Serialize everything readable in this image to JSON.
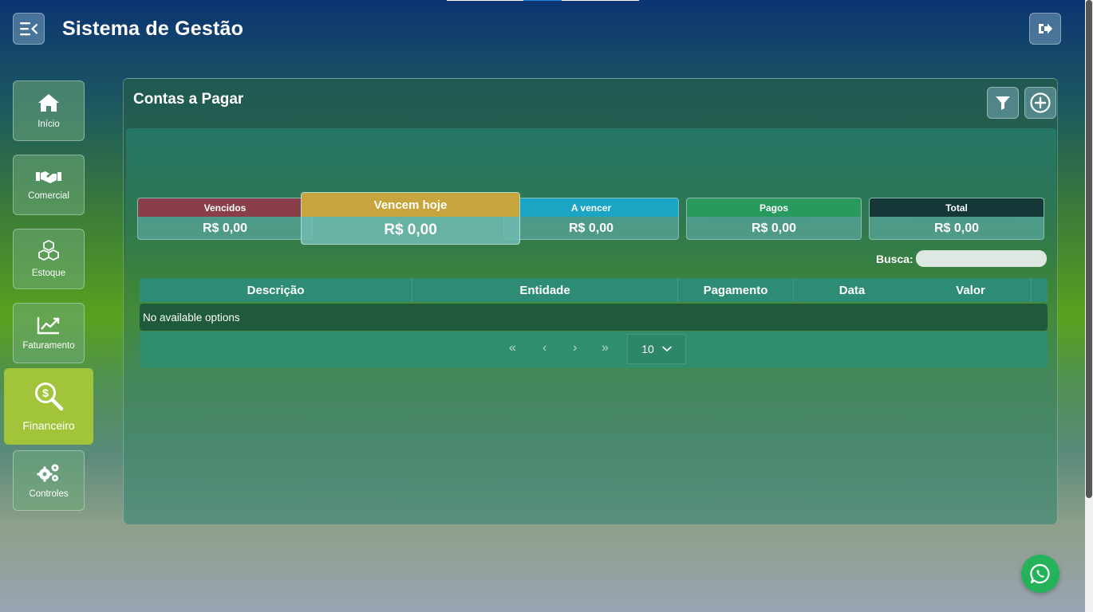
{
  "app": {
    "title": "Sistema de Gestão"
  },
  "header": {
    "menu_icon": "menu-collapse-icon",
    "logout_icon": "logout-icon"
  },
  "sidebar": {
    "items": [
      {
        "label": "Início",
        "icon": "home-icon"
      },
      {
        "label": "Comercial",
        "icon": "handshake-icon"
      },
      {
        "label": "Estoque",
        "icon": "boxes-icon"
      },
      {
        "label": "Faturamento",
        "icon": "chart-line-icon"
      },
      {
        "label": "Financeiro",
        "icon": "money-search-icon",
        "active": true
      },
      {
        "label": "Controles",
        "icon": "gears-icon"
      }
    ]
  },
  "page": {
    "title": "Contas a Pagar",
    "filter_icon": "filter-icon",
    "add_icon": "plus-circle-icon"
  },
  "summary": {
    "cards": [
      {
        "label": "Vencidos",
        "value": "R$ 0,00",
        "color": "#8a3e4a"
      },
      {
        "label": "Vencem hoje",
        "value": "R$ 0,00",
        "color": "#c7a53c"
      },
      {
        "label": "A vencer",
        "value": "R$ 0,00",
        "color": "#1aa5c4"
      },
      {
        "label": "Pagos",
        "value": "R$ 0,00",
        "color": "#289a5e"
      },
      {
        "label": "Total",
        "value": "R$ 0,00",
        "color": "#173838"
      }
    ]
  },
  "search": {
    "label": "Busca:",
    "value": "",
    "placeholder": ""
  },
  "table": {
    "columns": [
      "Descrição",
      "Entidade",
      "Pagamento",
      "Data",
      "Valor"
    ],
    "empty_text": "No available options"
  },
  "pagination": {
    "first": "«",
    "prev": "‹",
    "next": "›",
    "last": "»",
    "page_size": "10"
  },
  "colors": {
    "active_sidebar": "#a2c43a",
    "whatsapp": "#25b35a"
  },
  "whatsapp": {
    "icon": "whatsapp-icon"
  }
}
